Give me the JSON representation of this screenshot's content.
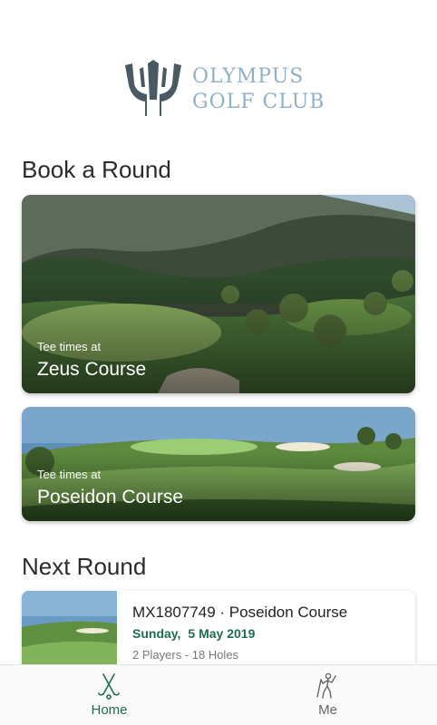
{
  "logo": {
    "line1": "OLYMPUS",
    "line2": "GOLF CLUB",
    "color": "#8fb0c6",
    "icon": "trident-icon"
  },
  "book": {
    "title": "Book a Round",
    "courses": [
      {
        "subtitle": "Tee times at",
        "name": "Zeus Course"
      },
      {
        "subtitle": "Tee times at",
        "name": "Poseidon Course"
      }
    ]
  },
  "next": {
    "title": "Next Round",
    "reference": "MX1807749 · Poseidon Course",
    "day": "Sunday,",
    "date": "5 May 2019",
    "details": "2 Players - 18 Holes"
  },
  "tabs": [
    {
      "label": "Home",
      "icon": "golf-clubs-icon",
      "active": true
    },
    {
      "label": "Me",
      "icon": "golfer-icon",
      "active": false
    }
  ],
  "colors": {
    "accent": "#1e6b50",
    "logo": "#8fb0c6"
  }
}
